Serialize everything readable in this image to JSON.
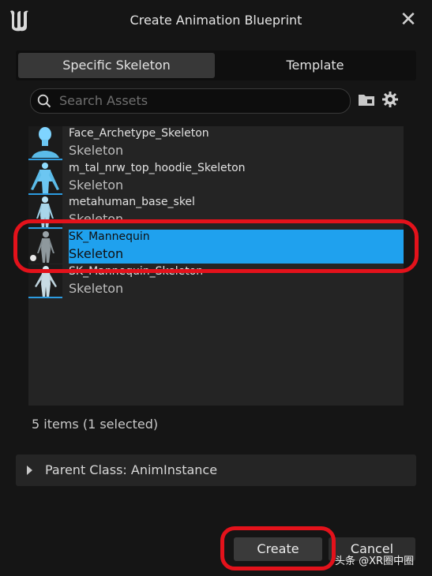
{
  "window": {
    "title": "Create Animation Blueprint",
    "logo_icon": "unreal-engine-logo",
    "close_glyph": "✕"
  },
  "tabs": [
    {
      "label": "Specific Skeleton",
      "active": true
    },
    {
      "label": "Template",
      "active": false
    }
  ],
  "search": {
    "placeholder": "Search Assets",
    "value": ""
  },
  "toolbar": {
    "folder_icon": "folder-icon",
    "settings_icon": "gear-icon"
  },
  "assets": {
    "items": [
      {
        "name": "Face_Archetype_Skeleton",
        "type": "Skeleton",
        "selected": false
      },
      {
        "name": "m_tal_nrw_top_hoodie_Skeleton",
        "type": "Skeleton",
        "selected": false
      },
      {
        "name": "metahuman_base_skel",
        "type": "Skeleton",
        "selected": false
      },
      {
        "name": "SK_Mannequin",
        "type": "Skeleton",
        "selected": true
      },
      {
        "name": "SK_Mannequin_Skeleton",
        "type": "Skeleton",
        "selected": false
      }
    ],
    "count_text": "5 items (1 selected)"
  },
  "parent_class": {
    "label": "Parent Class: AnimInstance",
    "expanded": false
  },
  "buttons": {
    "create": "Create",
    "cancel": "Cancel"
  },
  "colors": {
    "selection": "#1fa1ee",
    "annotation": "#e3121b",
    "thumb_bar": "#2c9be0"
  },
  "watermark": "头条 @XR圈中圈"
}
